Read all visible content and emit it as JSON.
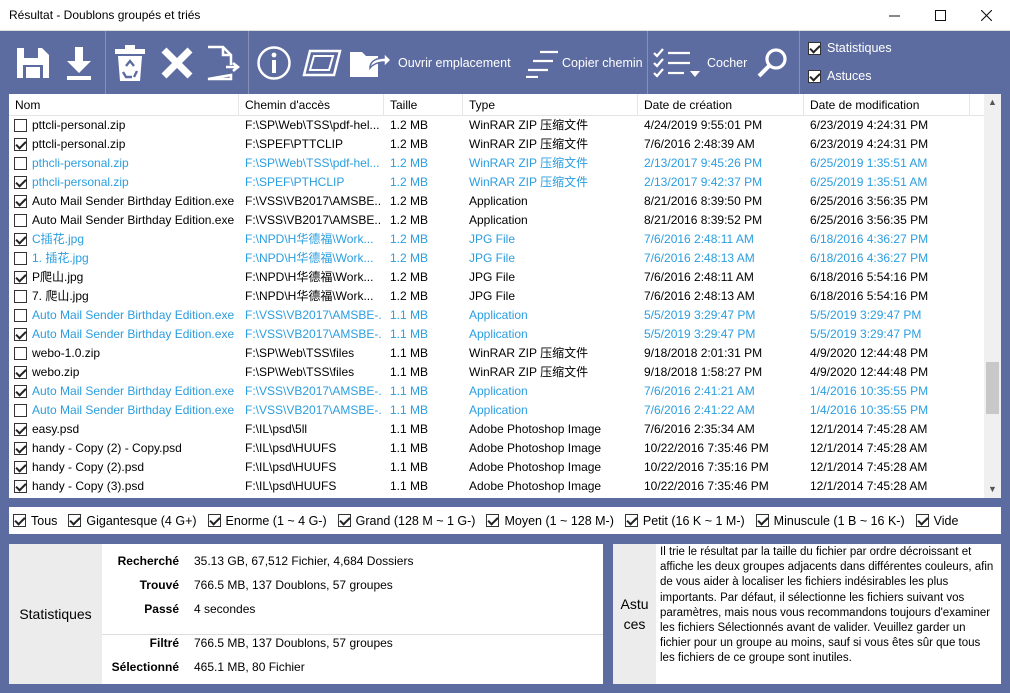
{
  "window": {
    "title": "Résultat - Doublons groupés et triés"
  },
  "toolbar": {
    "open_location_label": "Ouvrir emplacement",
    "copy_path_label": "Copier chemin",
    "check_label": "Cocher",
    "statistics_label": "Statistiques",
    "tips_label": "Astuces",
    "statistics_checked": true,
    "tips_checked": true
  },
  "columns": [
    "Nom",
    "Chemin d'accès",
    "Taille",
    "Type",
    "Date de création",
    "Date de modification"
  ],
  "rows": [
    {
      "checked": false,
      "blue": false,
      "name": "pttcli-personal.zip",
      "path": "F:\\SP\\Web\\TSS\\pdf-hel...",
      "size": "1.2 MB",
      "type": "WinRAR ZIP 压缩文件",
      "created": "4/24/2019 9:55:01 PM",
      "modified": "6/23/2019 4:24:31 PM"
    },
    {
      "checked": true,
      "blue": false,
      "name": "pttcli-personal.zip",
      "path": "F:\\SPEF\\PTTCLIP",
      "size": "1.2 MB",
      "type": "WinRAR ZIP 压缩文件",
      "created": "7/6/2016 2:48:39 AM",
      "modified": "6/23/2019 4:24:31 PM"
    },
    {
      "checked": false,
      "blue": true,
      "name": "pthcli-personal.zip",
      "path": "F:\\SP\\Web\\TSS\\pdf-hel...",
      "size": "1.2 MB",
      "type": "WinRAR ZIP 压缩文件",
      "created": "2/13/2017 9:45:26 PM",
      "modified": "6/25/2019 1:35:51 AM"
    },
    {
      "checked": true,
      "blue": true,
      "name": "pthcli-personal.zip",
      "path": "F:\\SPEF\\PTHCLIP",
      "size": "1.2 MB",
      "type": "WinRAR ZIP 压缩文件",
      "created": "2/13/2017 9:42:37 PM",
      "modified": "6/25/2019 1:35:51 AM"
    },
    {
      "checked": true,
      "blue": false,
      "name": "Auto Mail Sender Birthday Edition.exe",
      "path": "F:\\VSS\\VB2017\\AMSBE...",
      "size": "1.2 MB",
      "type": "Application",
      "created": "8/21/2016 8:39:50 PM",
      "modified": "6/25/2016 3:56:35 PM"
    },
    {
      "checked": false,
      "blue": false,
      "name": "Auto Mail Sender Birthday Edition.exe",
      "path": "F:\\VSS\\VB2017\\AMSBE...",
      "size": "1.2 MB",
      "type": "Application",
      "created": "8/21/2016 8:39:52 PM",
      "modified": "6/25/2016 3:56:35 PM"
    },
    {
      "checked": true,
      "blue": true,
      "name": "C插花.jpg",
      "path": "F:\\NPD\\H华德福\\Work...",
      "size": "1.2 MB",
      "type": "JPG File",
      "created": "7/6/2016 2:48:11 AM",
      "modified": "6/18/2016 4:36:27 PM"
    },
    {
      "checked": false,
      "blue": true,
      "name": "1. 插花.jpg",
      "path": "F:\\NPD\\H华德福\\Work...",
      "size": "1.2 MB",
      "type": "JPG File",
      "created": "7/6/2016 2:48:13 AM",
      "modified": "6/18/2016 4:36:27 PM"
    },
    {
      "checked": true,
      "blue": false,
      "name": "P爬山.jpg",
      "path": "F:\\NPD\\H华德福\\Work...",
      "size": "1.2 MB",
      "type": "JPG File",
      "created": "7/6/2016 2:48:11 AM",
      "modified": "6/18/2016 5:54:16 PM"
    },
    {
      "checked": false,
      "blue": false,
      "name": "7. 爬山.jpg",
      "path": "F:\\NPD\\H华德福\\Work...",
      "size": "1.2 MB",
      "type": "JPG File",
      "created": "7/6/2016 2:48:13 AM",
      "modified": "6/18/2016 5:54:16 PM"
    },
    {
      "checked": false,
      "blue": true,
      "name": "Auto Mail Sender Birthday Edition.exe",
      "path": "F:\\VSS\\VB2017\\AMSBE-...",
      "size": "1.1 MB",
      "type": "Application",
      "created": "5/5/2019 3:29:47 PM",
      "modified": "5/5/2019 3:29:47 PM"
    },
    {
      "checked": true,
      "blue": true,
      "name": "Auto Mail Sender Birthday Edition.exe",
      "path": "F:\\VSS\\VB2017\\AMSBE-...",
      "size": "1.1 MB",
      "type": "Application",
      "created": "5/5/2019 3:29:47 PM",
      "modified": "5/5/2019 3:29:47 PM"
    },
    {
      "checked": false,
      "blue": false,
      "name": "webo-1.0.zip",
      "path": "F:\\SP\\Web\\TSS\\files",
      "size": "1.1 MB",
      "type": "WinRAR ZIP 压缩文件",
      "created": "9/18/2018 2:01:31 PM",
      "modified": "4/9/2020 12:44:48 PM"
    },
    {
      "checked": true,
      "blue": false,
      "name": "webo.zip",
      "path": "F:\\SP\\Web\\TSS\\files",
      "size": "1.1 MB",
      "type": "WinRAR ZIP 压缩文件",
      "created": "9/18/2018 1:58:27 PM",
      "modified": "4/9/2020 12:44:48 PM"
    },
    {
      "checked": true,
      "blue": true,
      "name": "Auto Mail Sender Birthday Edition.exe",
      "path": "F:\\VSS\\VB2017\\AMSBE-...",
      "size": "1.1 MB",
      "type": "Application",
      "created": "7/6/2016 2:41:21 AM",
      "modified": "1/4/2016 10:35:55 PM"
    },
    {
      "checked": false,
      "blue": true,
      "name": "Auto Mail Sender Birthday Edition.exe",
      "path": "F:\\VSS\\VB2017\\AMSBE-...",
      "size": "1.1 MB",
      "type": "Application",
      "created": "7/6/2016 2:41:22 AM",
      "modified": "1/4/2016 10:35:55 PM"
    },
    {
      "checked": true,
      "blue": false,
      "name": "easy.psd",
      "path": "F:\\IL\\psd\\5ll",
      "size": "1.1 MB",
      "type": "Adobe Photoshop Image",
      "created": "7/6/2016 2:35:34 AM",
      "modified": "12/1/2014 7:45:28 AM"
    },
    {
      "checked": true,
      "blue": false,
      "name": "handy - Copy (2) - Copy.psd",
      "path": "F:\\IL\\psd\\HUUFS",
      "size": "1.1 MB",
      "type": "Adobe Photoshop Image",
      "created": "10/22/2016 7:35:46 PM",
      "modified": "12/1/2014 7:45:28 AM"
    },
    {
      "checked": true,
      "blue": false,
      "name": "handy - Copy (2).psd",
      "path": "F:\\IL\\psd\\HUUFS",
      "size": "1.1 MB",
      "type": "Adobe Photoshop Image",
      "created": "10/22/2016 7:35:16 PM",
      "modified": "12/1/2014 7:45:28 AM"
    },
    {
      "checked": true,
      "blue": false,
      "name": "handy - Copy (3).psd",
      "path": "F:\\IL\\psd\\HUUFS",
      "size": "1.1 MB",
      "type": "Adobe Photoshop Image",
      "created": "10/22/2016 7:35:46 PM",
      "modified": "12/1/2014 7:45:28 AM"
    }
  ],
  "filters": [
    {
      "label": "Tous",
      "checked": true
    },
    {
      "label": "Gigantesque (4 G+)",
      "checked": true
    },
    {
      "label": "Enorme (1 ~ 4 G-)",
      "checked": true
    },
    {
      "label": "Grand (128 M ~ 1 G-)",
      "checked": true
    },
    {
      "label": "Moyen (1 ~ 128 M-)",
      "checked": true
    },
    {
      "label": "Petit (16 K ~ 1 M-)",
      "checked": true
    },
    {
      "label": "Minuscule (1 B ~ 16 K-)",
      "checked": true
    },
    {
      "label": "Vide",
      "checked": true
    }
  ],
  "statistics": {
    "title": "Statistiques",
    "searched_label": "Recherché",
    "searched_value": "35.13 GB, 67,512 Fichier, 4,684 Dossiers",
    "found_label": "Trouvé",
    "found_value": "766.5 MB, 137 Doublons, 57 groupes",
    "elapsed_label": "Passé",
    "elapsed_value": "4 secondes",
    "filtered_label": "Filtré",
    "filtered_value": "766.5 MB, 137 Doublons, 57 groupes",
    "selected_label": "Sélectionné",
    "selected_value": "465.1 MB, 80 Fichier"
  },
  "tips": {
    "title_line1": "Astu",
    "title_line2": "ces",
    "text": "Il trie le résultat par la taille du fichier par ordre décroissant et affiche les deux groupes adjacents dans différentes couleurs, afin de vous aider à localiser les fichiers indésirables les plus importants. Par défaut, il sélectionne les fichiers suivant vos paramètres, mais nous vous recommandons toujours d'examiner les fichiers Sélectionnés avant de valider. Veuillez garder un fichier pour un groupe au moins, sauf si vous êtes sûr que tous les fichiers de ce groupe sont inutiles."
  },
  "icons": {
    "save": "save-icon",
    "download": "download-icon",
    "recycle": "recycle-bin-icon",
    "delete": "delete-x-icon",
    "move": "move-file-icon",
    "info": "info-icon",
    "preview": "preview-icon",
    "open_folder": "open-folder-icon",
    "copy_path": "copy-path-icon",
    "check_list": "checklist-icon",
    "search": "search-icon"
  }
}
